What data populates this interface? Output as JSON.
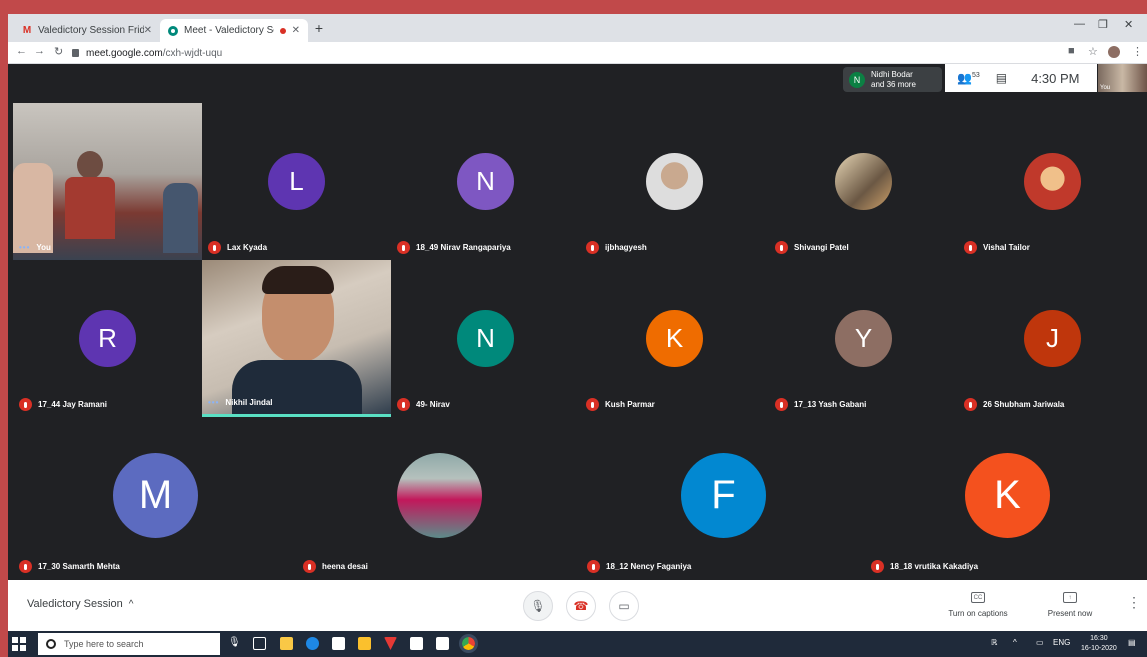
{
  "browser": {
    "tabs": [
      {
        "label": "Valedictory Session Friday, Octol",
        "favicon": "gmail-icon"
      },
      {
        "label": "Meet - Valedictory Session",
        "favicon": "meet-icon"
      }
    ],
    "url_host": "meet.google.com",
    "url_path": "/cxh-wjdt-uqu"
  },
  "meet": {
    "presence": {
      "initial": "N",
      "line1": "Nidhi Bodar",
      "line2": "and 36 more"
    },
    "participant_count": "53",
    "time": "4:30 PM",
    "self_thumb_label": "You",
    "participants": [
      {
        "name": "You",
        "type": "video",
        "muted": false
      },
      {
        "name": "Lax Kyada",
        "initial": "L",
        "color": "#5e35b1",
        "muted": true
      },
      {
        "name": "18_49 Nirav Rangapariya",
        "initial": "N",
        "color": "#7e57c2",
        "muted": true
      },
      {
        "name": "ijbhagyesh",
        "type": "photo",
        "muted": true
      },
      {
        "name": "Shivangi Patel",
        "type": "photo",
        "muted": true
      },
      {
        "name": "Vishal Tailor",
        "type": "photo",
        "muted": true
      },
      {
        "name": "17_44 Jay Ramani",
        "initial": "R",
        "color": "#5e35b1",
        "muted": true
      },
      {
        "name": "Nikhil Jindal",
        "type": "video",
        "muted": false,
        "speaking": true
      },
      {
        "name": "49- Nirav",
        "initial": "N",
        "color": "#00897b",
        "muted": true
      },
      {
        "name": "Kush Parmar",
        "initial": "K",
        "color": "#ef6c00",
        "muted": true
      },
      {
        "name": "17_13 Yash Gabani",
        "initial": "Y",
        "color": "#8d6e63",
        "muted": true
      },
      {
        "name": "26 Shubham Jariwala",
        "initial": "J",
        "color": "#bf360c",
        "muted": true
      },
      {
        "name": "17_30 Samarth Mehta",
        "initial": "M",
        "color": "#5c6bc0",
        "muted": true
      },
      {
        "name": "heena desai",
        "type": "photo",
        "muted": true
      },
      {
        "name": "18_12 Nency Faganiya",
        "initial": "F",
        "color": "#0288d1",
        "muted": true
      },
      {
        "name": "18_18 vrutika Kakadiya",
        "initial": "K",
        "color": "#f4511e",
        "muted": true
      }
    ],
    "meeting_title": "Valedictory Session",
    "captions_label": "Turn on captions",
    "present_label": "Present now"
  },
  "taskbar": {
    "search_placeholder": "Type here to search",
    "lang": "ENG",
    "clock_time": "16:30",
    "clock_date": "16-10-2020"
  }
}
